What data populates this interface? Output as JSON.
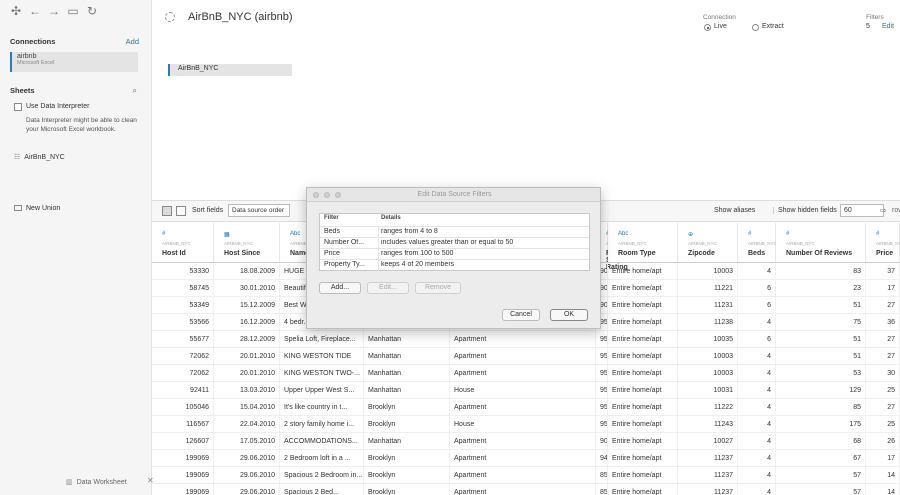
{
  "sidebar": {
    "connections_label": "Connections",
    "add_label": "Add",
    "connection": {
      "name": "airbnb",
      "type": "Microsoft Excel"
    },
    "sheets_label": "Sheets",
    "interpreter_label": "Use Data Interpreter",
    "interpreter_desc": "Data Interpreter might be able to clean your Microsoft Excel workbook.",
    "sheet_name": "AirBnB_NYC",
    "new_union_label": "New Union",
    "bottom_tab": "Data Worksheet"
  },
  "header": {
    "title": "AirBnB_NYC (airbnb)",
    "connection_label": "Connection",
    "live_label": "Live",
    "extract_label": "Extract",
    "filters_label": "Filters",
    "filters_count": "5",
    "filters_edit": "Edit"
  },
  "canvas": {
    "table_label": "AirBnB_NYC"
  },
  "gridbar": {
    "sort_label": "Sort fields",
    "sort_value": "Data source order",
    "aliases_label": "Show aliases",
    "hidden_label": "Show hidden fields",
    "rows_value": "60",
    "rows_suffix": "rows"
  },
  "grid": {
    "columns": [
      {
        "type_icon": "#",
        "source": "AIRBNB_NYC",
        "name": "Host Id"
      },
      {
        "type_icon": "▦",
        "source": "AIRBNB_NYC",
        "name": "Host Since"
      },
      {
        "type_icon": "Abc",
        "source": "AIRBNB_NYC",
        "name": "Name"
      },
      {
        "type_icon": "Abc",
        "source": "AIRBNB_NYC",
        "name": "Neighbourhood"
      },
      {
        "type_icon": "Abc",
        "source": "AIRBNB_NYC",
        "name": "Property Type"
      },
      {
        "type_icon": "#",
        "source": "AIRBNB_NYC",
        "name": "Review Scores Rating"
      },
      {
        "type_icon": "Abc",
        "source": "AIRBNB_NYC",
        "name": "Room Type"
      },
      {
        "type_icon": "⊕",
        "source": "AIRBNB_NYC",
        "name": "Zipcode"
      },
      {
        "type_icon": "#",
        "source": "AIRBNB_NYC",
        "name": "Beds"
      },
      {
        "type_icon": "#",
        "source": "AIRBNB_NYC",
        "name": "Number Of Reviews"
      },
      {
        "type_icon": "#",
        "source": "AIRBNB_NYC",
        "name": "Price"
      }
    ],
    "rows": [
      [
        "53330",
        "18.08.2009",
        "HUGE S...",
        "",
        "",
        "90",
        "Entire home/apt",
        "10003",
        "4",
        "83",
        "37"
      ],
      [
        "58745",
        "30.01.2010",
        "Beautif...",
        "",
        "",
        "90",
        "Entire home/apt",
        "11221",
        "6",
        "23",
        "17"
      ],
      [
        "53349",
        "15.12.2009",
        "Best W...",
        "",
        "",
        "90",
        "Entire home/apt",
        "11231",
        "6",
        "51",
        "27"
      ],
      [
        "53566",
        "16.12.2009",
        "4 bedr...",
        "",
        "",
        "95",
        "Entire home/apt",
        "11238",
        "4",
        "75",
        "36"
      ],
      [
        "55677",
        "28.12.2009",
        "Spelia Loft, Fireplace...",
        "Manhattan",
        "Apartment",
        "95",
        "Entire home/apt",
        "10035",
        "6",
        "51",
        "27"
      ],
      [
        "72062",
        "20.01.2010",
        "KING WESTON TIDE",
        "Manhattan",
        "Apartment",
        "95",
        "Entire home/apt",
        "10003",
        "4",
        "51",
        "27"
      ],
      [
        "72062",
        "20.01.2010",
        "KING WESTON TWO-...",
        "Manhattan",
        "Apartment",
        "95",
        "Entire home/apt",
        "10003",
        "4",
        "53",
        "30"
      ],
      [
        "92411",
        "13.03.2010",
        "Upper Upper West S...",
        "Manhattan",
        "House",
        "95",
        "Entire home/apt",
        "10031",
        "4",
        "129",
        "25"
      ],
      [
        "105046",
        "15.04.2010",
        "It's like country in t...",
        "Brooklyn",
        "Apartment",
        "95",
        "Entire home/apt",
        "11222",
        "4",
        "85",
        "27"
      ],
      [
        "116567",
        "22.04.2010",
        "2 story family home i...",
        "Brooklyn",
        "House",
        "95",
        "Entire home/apt",
        "11243",
        "4",
        "175",
        "25"
      ],
      [
        "126607",
        "17.05.2010",
        "ACCOMMODATIONS...",
        "Manhattan",
        "Apartment",
        "90",
        "Entire home/apt",
        "10027",
        "4",
        "68",
        "26"
      ],
      [
        "199069",
        "29.06.2010",
        "2 Bedroom loft in a ...",
        "Brooklyn",
        "Apartment",
        "94",
        "Entire home/apt",
        "11237",
        "4",
        "67",
        "17"
      ],
      [
        "199069",
        "29.06.2010",
        "Spacious 2 Bedroom in...",
        "Brooklyn",
        "Apartment",
        "85",
        "Entire home/apt",
        "11237",
        "4",
        "57",
        "14"
      ],
      [
        "199069",
        "29.06.2010",
        "Spacious 2 Bed...",
        "Brooklyn",
        "Apartment",
        "85",
        "Entire home/apt",
        "11237",
        "4",
        "57",
        "14"
      ]
    ]
  },
  "dialog": {
    "title": "Edit Data Source Filters",
    "header_filter": "Filter",
    "header_details": "Details",
    "rows": [
      {
        "filter": "Beds",
        "details": "ranges from 4 to 8"
      },
      {
        "filter": "Number Of...",
        "details": "includes values greater than or equal to 50"
      },
      {
        "filter": "Price",
        "details": "ranges from 100 to 500"
      },
      {
        "filter": "Property Ty...",
        "details": "keeps 4 of 20 members"
      }
    ],
    "add_label": "Add...",
    "edit_label": "Edit...",
    "remove_label": "Remove",
    "cancel_label": "Cancel",
    "ok_label": "OK"
  }
}
